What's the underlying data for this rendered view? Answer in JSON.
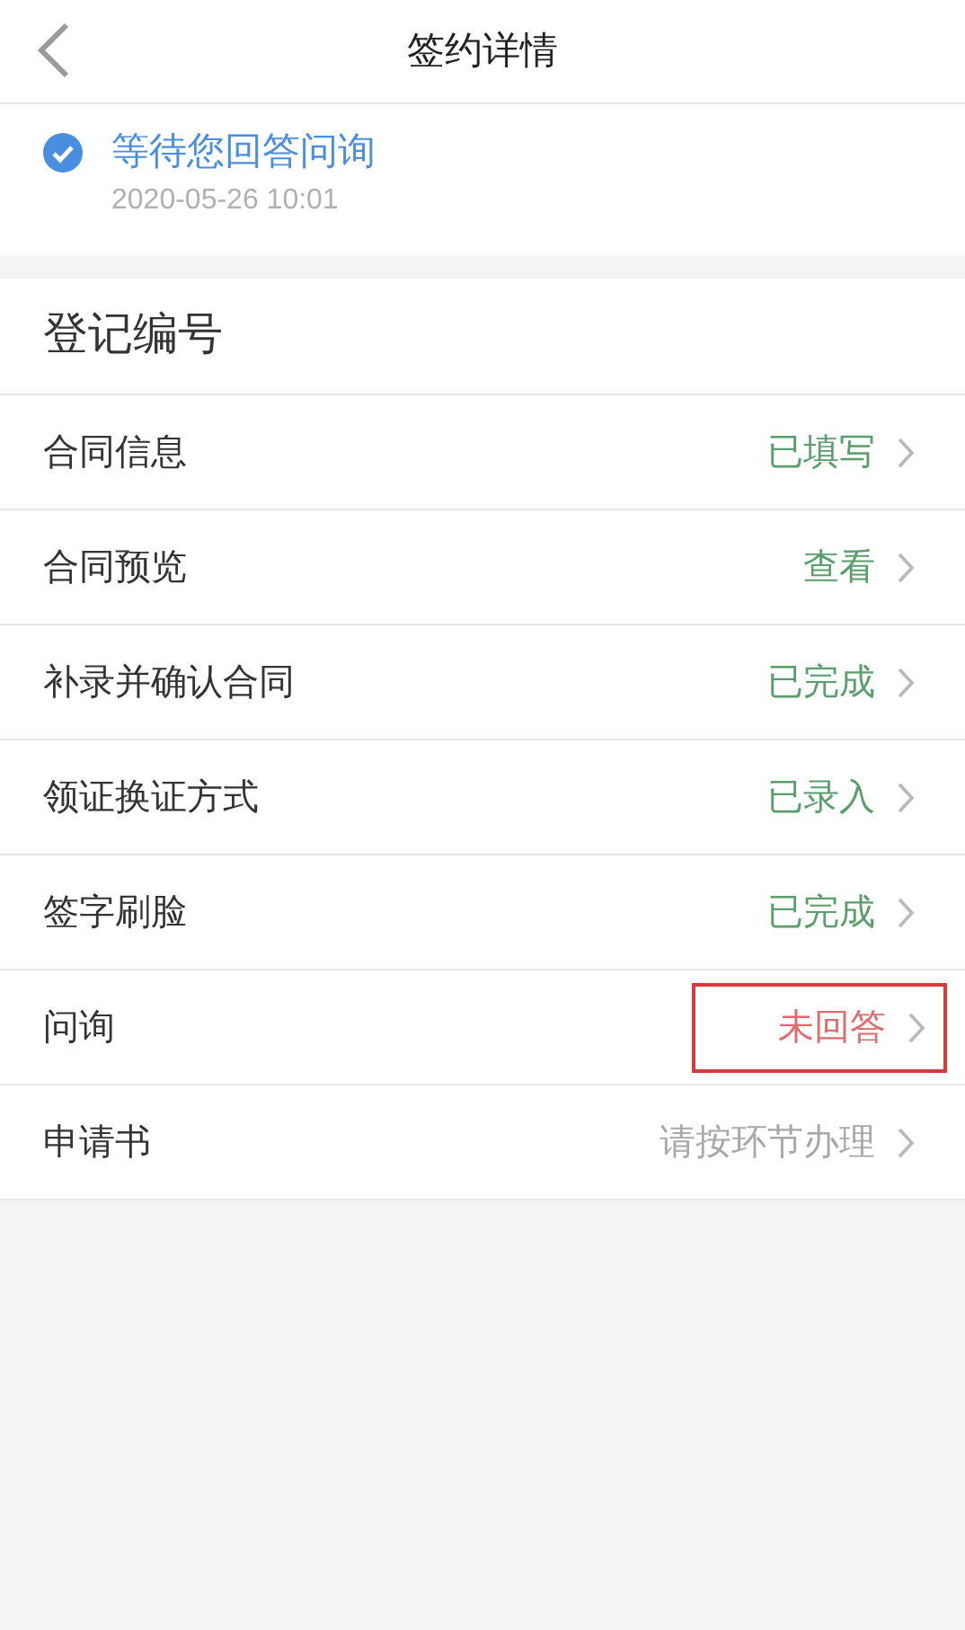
{
  "nav_bar": {
    "title": "签约详情"
  },
  "status": {
    "checked": true,
    "text": "等待您回答问询",
    "time": "2020-05-26 10:01"
  },
  "section": {
    "title": "登记编号",
    "rows": [
      {
        "label": "合同信息",
        "value": "已填写",
        "color": "#5a9e6b",
        "highlighted": false
      },
      {
        "label": "合同预览",
        "value": "查看",
        "color": "#5a9e6b",
        "highlighted": false
      },
      {
        "label": "补录并确认合同",
        "value": "已完成",
        "color": "#5a9e6b",
        "highlighted": false
      },
      {
        "label": "领证换证方式",
        "value": "已录入",
        "color": "#5a9e6b",
        "highlighted": false
      },
      {
        "label": "签字刷脸",
        "value": "已完成",
        "color": "#5a9e6b",
        "highlighted": false
      },
      {
        "label": "问询",
        "value": "未回答",
        "color": "#e26a6c",
        "highlighted": true
      },
      {
        "label": "申请书",
        "value": "请按环节办理",
        "color": "#a8a8a8",
        "highlighted": false
      }
    ]
  }
}
